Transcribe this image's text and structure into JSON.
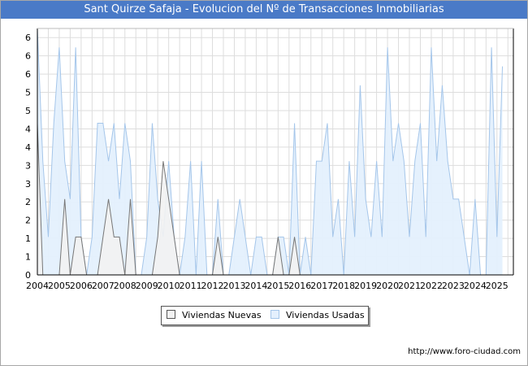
{
  "title": "Sant Quirze Safaja - Evolucion del Nº de Transacciones Inmobiliarias",
  "footer": "http://www.foro-ciudad.com",
  "colors": {
    "title_bg": "#4a7ac7",
    "nuevas_fill": "#f2f2f2",
    "nuevas_line": "#777777",
    "usadas_fill": "#e4f0fd",
    "usadas_line": "#a5c6ea"
  },
  "chart_data": {
    "type": "area",
    "title": "Sant Quirze Safaja - Evolucion del Nº de Transacciones Inmobiliarias",
    "xlabel": "",
    "ylabel": "",
    "x_start": "2004 Q1",
    "x_step": "quarter",
    "x_tick_labels": [
      "2004",
      "2005",
      "2006",
      "2007",
      "2008",
      "2009",
      "2010",
      "2011",
      "2012",
      "2013",
      "2014",
      "2015",
      "2016",
      "2017",
      "2018",
      "2019",
      "2020",
      "2021",
      "2022",
      "2023",
      "2024",
      "2025"
    ],
    "y_tick_labels": [
      "0",
      "1",
      "1",
      "2",
      "2",
      "3",
      "3",
      "4",
      "4",
      "5",
      "5",
      "6",
      "6",
      "6"
    ],
    "ylim": [
      0,
      6.5
    ],
    "grid": true,
    "legend_position": "bottom-center",
    "series": [
      {
        "name": "Viviendas Nuevas",
        "values": [
          4,
          0,
          0,
          0,
          0,
          2,
          0,
          1,
          1,
          0,
          0,
          0,
          1,
          2,
          1,
          1,
          0,
          2,
          0,
          0,
          0,
          0,
          1,
          3,
          2,
          1,
          0,
          0,
          0,
          0,
          0,
          0,
          0,
          1,
          0,
          0,
          0,
          0,
          0,
          0,
          0,
          0,
          0,
          0,
          1,
          0,
          0,
          1,
          0,
          0,
          0,
          0,
          0,
          0,
          0,
          0,
          0,
          0,
          0,
          0,
          0,
          0,
          0,
          0,
          0,
          0,
          0,
          0,
          0,
          0,
          0,
          0,
          0,
          0,
          0,
          0,
          0,
          0,
          0,
          0,
          0,
          0,
          0,
          0,
          0,
          0,
          0,
          0
        ]
      },
      {
        "name": "Viviendas Usadas",
        "values": [
          6.5,
          3,
          1,
          4,
          6,
          3,
          2,
          6,
          1,
          0,
          1,
          4,
          4,
          3,
          4,
          2,
          4,
          3,
          0,
          0,
          1,
          4,
          2,
          1,
          3,
          1,
          0,
          1,
          3,
          0,
          3,
          0,
          0,
          2,
          0,
          0,
          1,
          2,
          1,
          0,
          1,
          1,
          0,
          0,
          1,
          1,
          0,
          4,
          0,
          1,
          0,
          3,
          3,
          4,
          1,
          2,
          0,
          3,
          1,
          5,
          2,
          1,
          3,
          1,
          6,
          3,
          4,
          3,
          1,
          3,
          4,
          1,
          6,
          3,
          5,
          3,
          2,
          2,
          1,
          0,
          2,
          0,
          0,
          6,
          1,
          5.5
        ]
      }
    ]
  }
}
